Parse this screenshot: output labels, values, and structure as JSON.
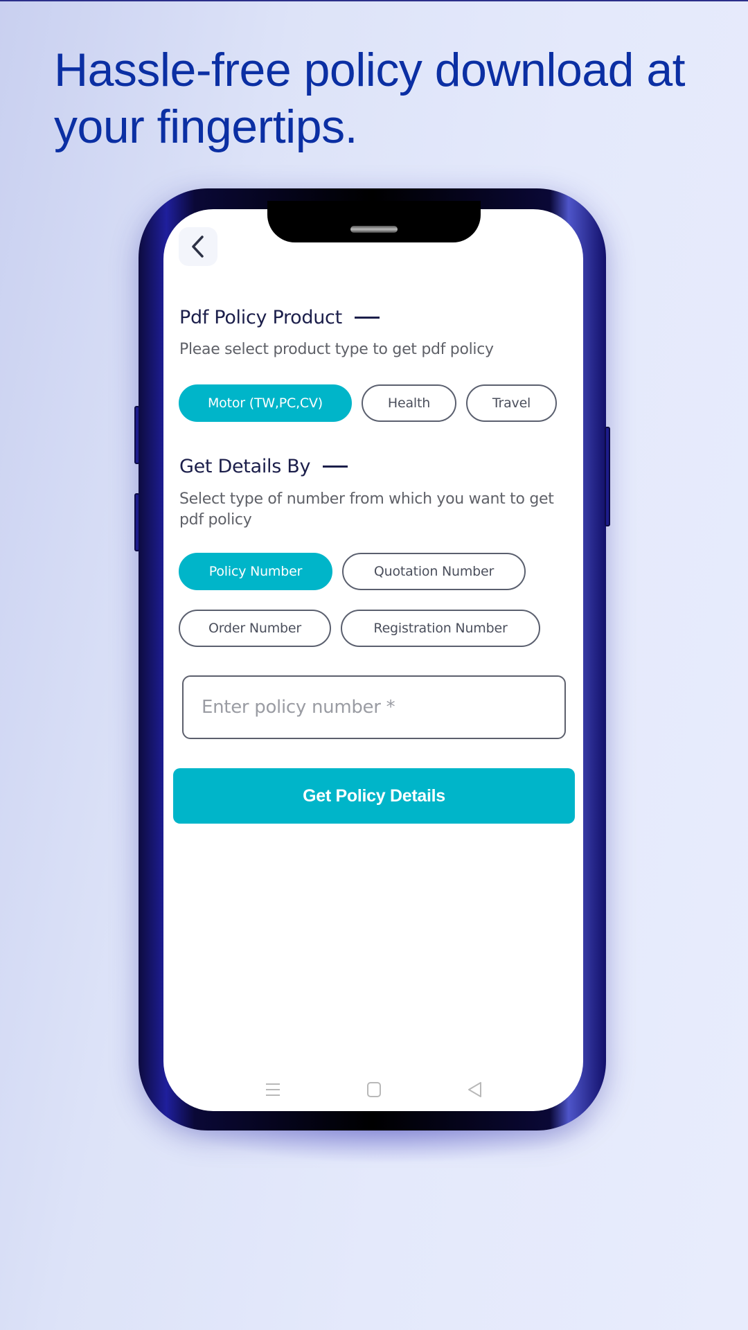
{
  "promo": {
    "headline_line1": "Hassle-free policy download at",
    "headline_line2": "your fingertips."
  },
  "app": {
    "back_icon": "chevron-left-icon",
    "product_section": {
      "title": "Pdf Policy Product",
      "subtitle": "Pleae select product type to get pdf policy",
      "options": [
        {
          "label": "Motor (TW,PC,CV)",
          "selected": true
        },
        {
          "label": "Health",
          "selected": false
        },
        {
          "label": "Travel",
          "selected": false
        }
      ]
    },
    "details_section": {
      "title": "Get Details By",
      "subtitle": "Select type of number from which you want to get pdf policy",
      "options": [
        {
          "label": "Policy Number",
          "selected": true
        },
        {
          "label": "Quotation Number",
          "selected": false
        },
        {
          "label": "Order Number",
          "selected": false
        },
        {
          "label": "Registration Number",
          "selected": false
        }
      ]
    },
    "policy_input": {
      "value": "",
      "placeholder": "Enter policy number *"
    },
    "submit_label": "Get Policy Details"
  },
  "system_nav": {
    "items": [
      "menu-icon",
      "home-square-icon",
      "back-triangle-icon"
    ]
  },
  "colors": {
    "accent": "#00b5c9",
    "headline": "#0b2fa3",
    "title_text": "#1b1e4a",
    "phone_frame": "#1f1f9c"
  }
}
